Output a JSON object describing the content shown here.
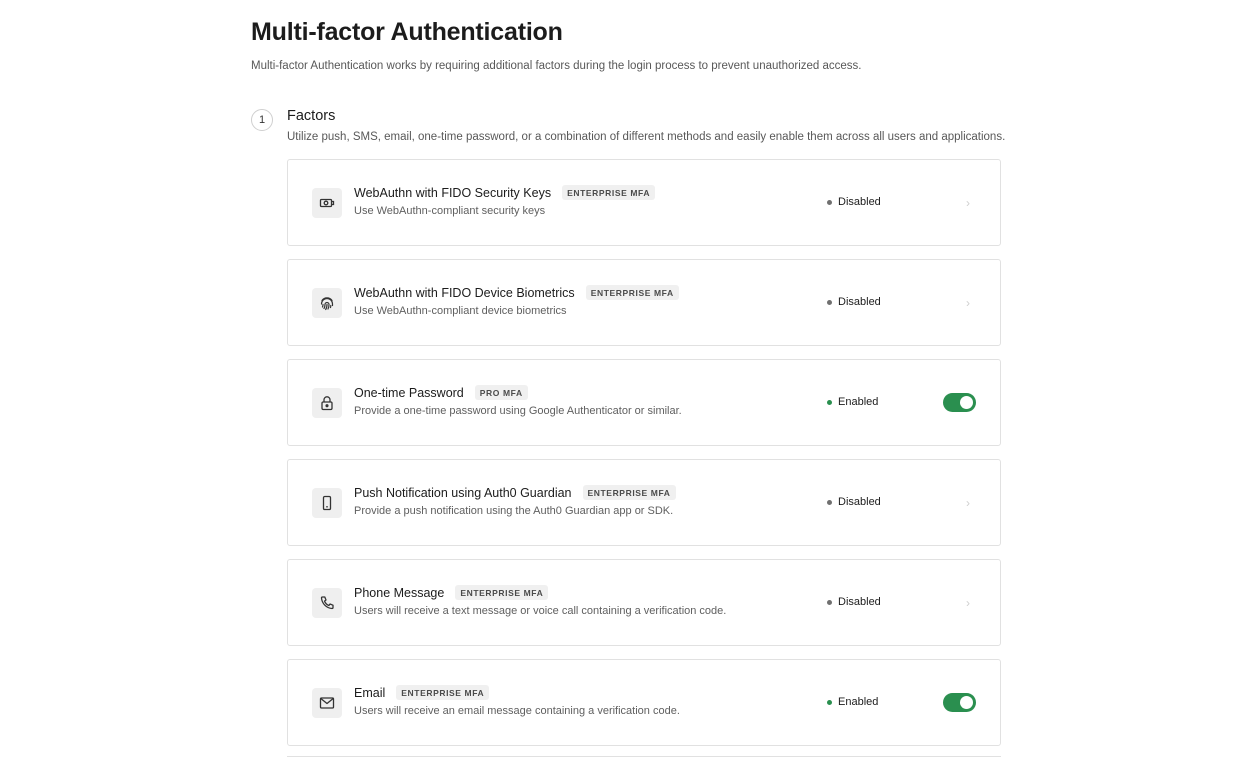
{
  "page": {
    "title": "Multi-factor Authentication",
    "description": "Multi-factor Authentication works by requiring additional factors during the login process to prevent unauthorized access."
  },
  "section": {
    "step": "1",
    "title": "Factors",
    "description": "Utilize push, SMS, email, one-time password, or a combination of different methods and easily enable them across all users and applications."
  },
  "colors": {
    "enabled": "#2a8f4f",
    "disabled": "#707070",
    "toggle_on": "#2a8f4f"
  },
  "factors": [
    {
      "name": "WebAuthn with FIDO Security Keys",
      "badge": "ENTERPRISE MFA",
      "description": "Use WebAuthn-compliant security keys",
      "status": "Disabled",
      "enabled": false,
      "icon": "security-key-icon"
    },
    {
      "name": "WebAuthn with FIDO Device Biometrics",
      "badge": "ENTERPRISE MFA",
      "description": "Use WebAuthn-compliant device biometrics",
      "status": "Disabled",
      "enabled": false,
      "icon": "fingerprint-icon"
    },
    {
      "name": "One-time Password",
      "badge": "PRO MFA",
      "description": "Provide a one-time password using Google Authenticator or similar.",
      "status": "Enabled",
      "enabled": true,
      "icon": "lock-icon"
    },
    {
      "name": "Push Notification using Auth0 Guardian",
      "badge": "ENTERPRISE MFA",
      "description": "Provide a push notification using the Auth0 Guardian app or SDK.",
      "status": "Disabled",
      "enabled": false,
      "icon": "mobile-phone-icon"
    },
    {
      "name": "Phone Message",
      "badge": "ENTERPRISE MFA",
      "description": "Users will receive a text message or voice call containing a verification code.",
      "status": "Disabled",
      "enabled": false,
      "icon": "phone-icon"
    },
    {
      "name": "Email",
      "badge": "ENTERPRISE MFA",
      "description": "Users will receive an email message containing a verification code.",
      "status": "Enabled",
      "enabled": true,
      "icon": "email-icon"
    }
  ]
}
